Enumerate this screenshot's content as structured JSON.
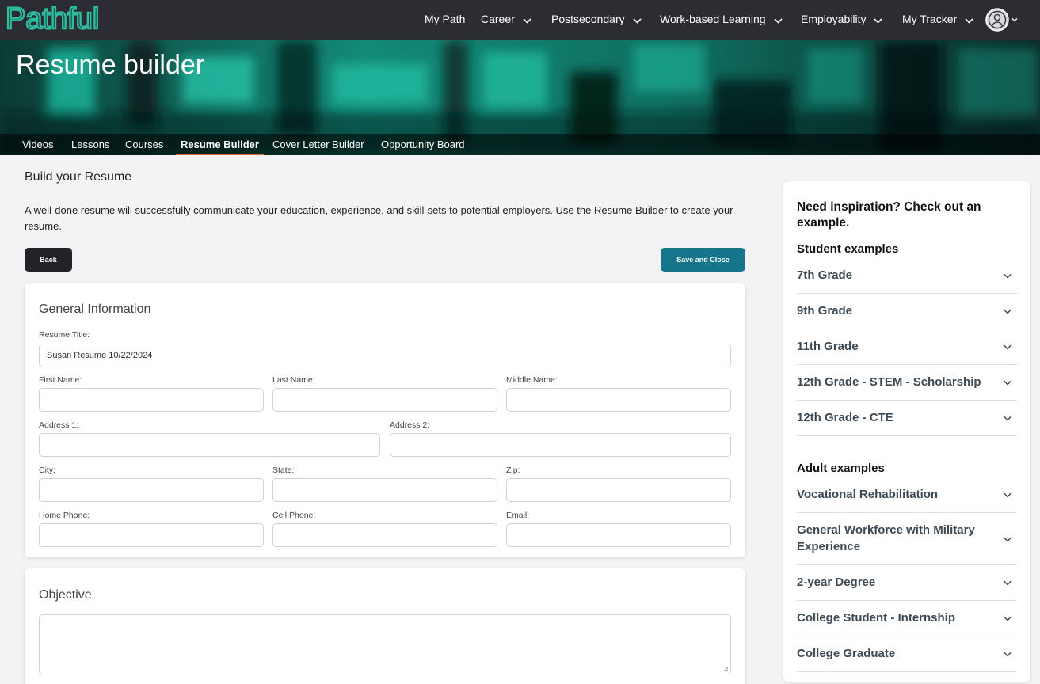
{
  "app": {
    "logo_text": "Pathful"
  },
  "topnav": {
    "items": [
      {
        "label": "My Path",
        "has_dropdown": false
      },
      {
        "label": "Career",
        "has_dropdown": true
      },
      {
        "label": "Postsecondary",
        "has_dropdown": true
      },
      {
        "label": "Work-based Learning",
        "has_dropdown": true
      },
      {
        "label": "Employability",
        "has_dropdown": true
      },
      {
        "label": "My Tracker",
        "has_dropdown": true
      }
    ],
    "avatar_icon": "user-circle-icon"
  },
  "hero": {
    "title": "Resume builder"
  },
  "subnav": {
    "items": [
      {
        "label": "Videos"
      },
      {
        "label": "Lessons"
      },
      {
        "label": "Courses"
      },
      {
        "label": "Resume Builder",
        "active": true
      },
      {
        "label": "Cover Letter Builder"
      },
      {
        "label": "Opportunity Board"
      }
    ]
  },
  "main": {
    "heading": "Build your Resume",
    "intro": "A well-done resume will successfully communicate your education, experience, and skill-sets to potential employers. Use the Resume Builder to create your resume.",
    "back_label": "Back",
    "save_label": "Save and Close"
  },
  "general": {
    "title": "General Information",
    "resume_title_label": "Resume Title:",
    "resume_title_value": "Susan Resume 10/22/2024",
    "first_name_label": "First Name:",
    "last_name_label": "Last Name:",
    "middle_name_label": "Middle Name:",
    "address1_label": "Address 1:",
    "address2_label": "Address 2:",
    "city_label": "City:",
    "state_label": "State:",
    "zip_label": "Zip:",
    "home_phone_label": "Home Phone:",
    "cell_phone_label": "Cell Phone:",
    "email_label": "Email:"
  },
  "objective": {
    "title": "Objective"
  },
  "sidebar": {
    "heading": "Need inspiration? Check out an example.",
    "student_title": "Student examples",
    "student_items": [
      "7th Grade",
      "9th Grade",
      "11th Grade",
      "12th Grade - STEM - Scholarship",
      "12th Grade - CTE"
    ],
    "adult_title": "Adult examples",
    "adult_items": [
      "Vocational Rehabilitation",
      "General Workforce with Military Experience",
      "2-year Degree",
      "College Student - Internship",
      "College Graduate"
    ]
  },
  "colors": {
    "nav_bg": "#2b2d33",
    "brand_teal": "#16758a",
    "logo_teal": "#2bbfa0",
    "active_tab_underline": "#e8642c"
  }
}
